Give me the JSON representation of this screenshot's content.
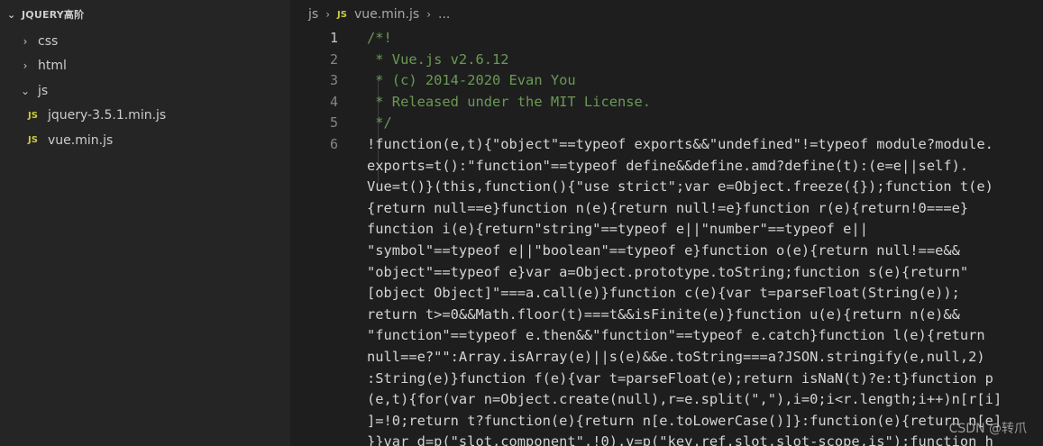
{
  "sidebar": {
    "header": "JQUERY高阶",
    "items": [
      {
        "label": "css"
      },
      {
        "label": "html"
      },
      {
        "label": "js"
      }
    ],
    "files": [
      {
        "icon": "JS",
        "label": "jquery-3.5.1.min.js"
      },
      {
        "icon": "JS",
        "label": "vue.min.js"
      }
    ]
  },
  "breadcrumb": {
    "folder": "js",
    "icon": "JS",
    "file": "vue.min.js",
    "more": "..."
  },
  "line_numbers": [
    "1",
    "2",
    "3",
    "4",
    "5",
    "6"
  ],
  "code_lines": [
    "/*!",
    " * Vue.js v2.6.12",
    " * (c) 2014-2020 Evan You",
    " * Released under the MIT License.",
    " */",
    "!function(e,t){\"object\"==typeof exports&&\"undefined\"!=typeof module?module.",
    "exports=t():\"function\"==typeof define&&define.amd?define(t):(e=e||self).",
    "Vue=t()}(this,function(){\"use strict\";var e=Object.freeze({});function t(e)",
    "{return null==e}function n(e){return null!=e}function r(e){return!0===e}",
    "function i(e){return\"string\"==typeof e||\"number\"==typeof e||",
    "\"symbol\"==typeof e||\"boolean\"==typeof e}function o(e){return null!==e&&",
    "\"object\"==typeof e}var a=Object.prototype.toString;function s(e){return\"",
    "[object Object]\"===a.call(e)}function c(e){var t=parseFloat(String(e));",
    "return t>=0&&Math.floor(t)===t&&isFinite(e)}function u(e){return n(e)&&",
    "\"function\"==typeof e.then&&\"function\"==typeof e.catch}function l(e){return",
    "null==e?\"\":Array.isArray(e)||s(e)&&e.toString===a?JSON.stringify(e,null,2)",
    ":String(e)}function f(e){var t=parseFloat(e);return isNaN(t)?e:t}function p",
    "(e,t){for(var n=Object.create(null),r=e.split(\",\"),i=0;i<r.length;i++)n[r[i]",
    "]=!0;return t?function(e){return n[e.toLowerCase()]}:function(e){return n[e]",
    "}}var d=p(\"slot,component\",!0),v=p(\"key,ref,slot,slot-scope,is\");function h"
  ],
  "watermark": "CSDN @转爪",
  "colors": {
    "background": "#1e1e1e",
    "sidebar": "#252526",
    "comment": "#6a9955",
    "text": "#d4d4d4",
    "js_icon": "#cbcb41"
  }
}
